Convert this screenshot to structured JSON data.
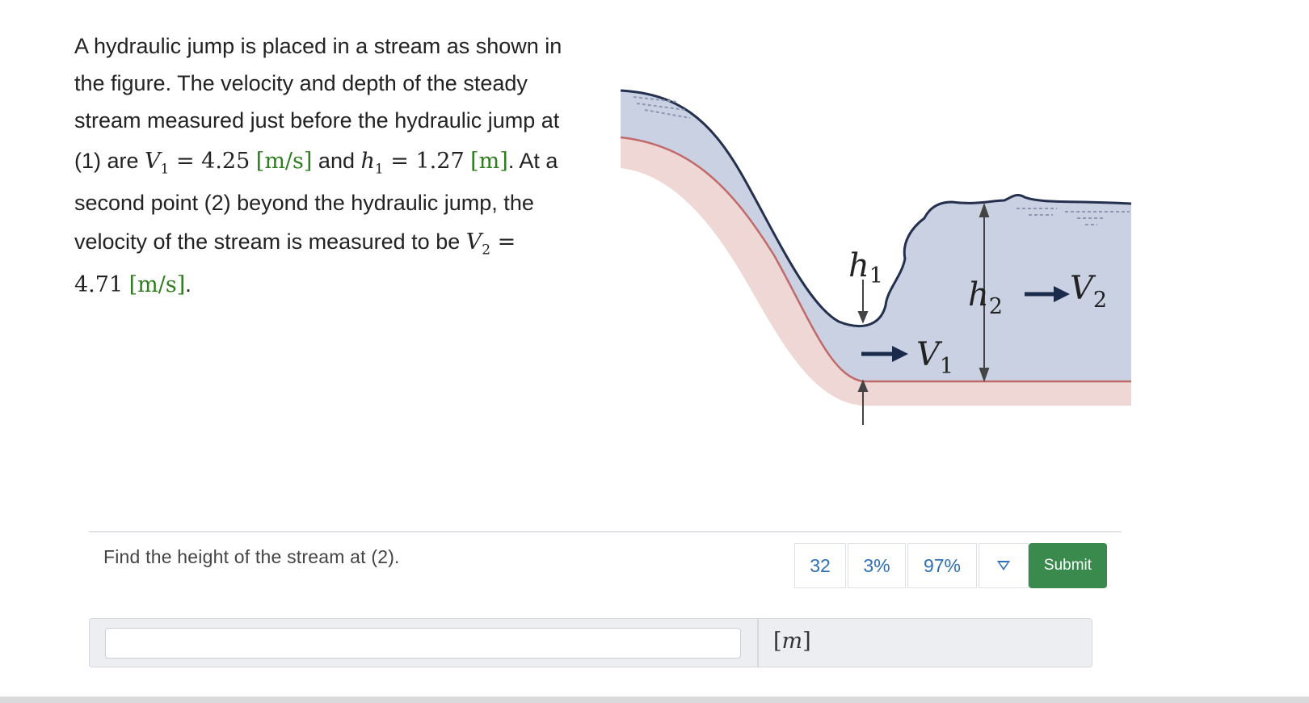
{
  "problem": {
    "line1": "A hydraulic jump is placed in a stream as shown in",
    "line2": "the figure. The velocity and depth of the steady",
    "line3": "stream measured just before the hydraulic jump at",
    "line4_a": "(1) are ",
    "v1_sym": "V",
    "v1_sub": "1",
    "eq1": " = ",
    "v1_val": "4.25",
    "v1_unit": "[m/s]",
    "and": " and ",
    "h1_sym": "h",
    "h1_sub": "1",
    "eq2": " = ",
    "h1_val": "1.27",
    "h1_unit": "[m]",
    "at_a": ". At a",
    "line5": "second point (2) beyond the hydraulic jump, the",
    "line6_a": "velocity of the stream is measured to be ",
    "v2_sym": "V",
    "v2_sub": "2",
    "eq3": " =",
    "v2_val": "4.71",
    "v2_unit": "[m/s]",
    "end": "."
  },
  "figure": {
    "h1_label": "h",
    "h1_sub": "1",
    "v1_label": "V",
    "v1_sub": "1",
    "h2_label": "h",
    "h2_sub": "2",
    "v2_label": "V",
    "v2_sub": "2",
    "colors": {
      "water": "#c9d1e3",
      "bed": "#efd7d6",
      "bed_line": "#c06a6a",
      "surface": "#24304d"
    }
  },
  "question": {
    "text": "Find the height of the stream at (2)."
  },
  "stats": {
    "attempts": "32",
    "wrong_pct": "3%",
    "right_pct": "97%"
  },
  "submit_label": "Submit",
  "answer": {
    "value": "",
    "unit": "m"
  }
}
